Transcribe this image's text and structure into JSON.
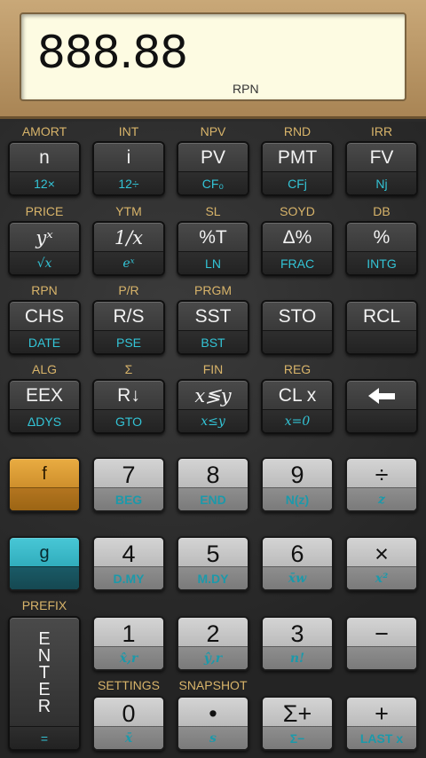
{
  "display": {
    "value": "888.88",
    "mode": "RPN"
  },
  "rows": [
    {
      "labels": [
        "AMORT",
        "INT",
        "NPV",
        "RND",
        "IRR"
      ],
      "keys": [
        {
          "main": "n",
          "sub": "12×"
        },
        {
          "main": "i",
          "sub": "12÷"
        },
        {
          "main": "PV",
          "sub": "CF₀"
        },
        {
          "main": "PMT",
          "sub": "CFj"
        },
        {
          "main": "FV",
          "sub": "Nj"
        }
      ]
    },
    {
      "labels": [
        "PRICE",
        "YTM",
        "SL",
        "SOYD",
        "DB"
      ],
      "keys": [
        {
          "main": "yˣ",
          "sub": "√x"
        },
        {
          "main": "1/x",
          "sub": "eˣ"
        },
        {
          "main": "%T",
          "sub": "LN"
        },
        {
          "main": "Δ%",
          "sub": "FRAC"
        },
        {
          "main": "%",
          "sub": "INTG"
        }
      ]
    },
    {
      "labels": [
        "RPN",
        "P/R",
        "PRGM",
        "",
        ""
      ],
      "keys": [
        {
          "main": "CHS",
          "sub": "DATE"
        },
        {
          "main": "R/S",
          "sub": "PSE"
        },
        {
          "main": "SST",
          "sub": "BST"
        },
        {
          "main": "STO",
          "sub": ""
        },
        {
          "main": "RCL",
          "sub": ""
        }
      ]
    },
    {
      "labels": [
        "ALG",
        "Σ",
        "FIN",
        "REG",
        ""
      ],
      "keys": [
        {
          "main": "EEX",
          "sub": "ΔDYS"
        },
        {
          "main": "R↓",
          "sub": "GTO"
        },
        {
          "main": "x≶y",
          "sub": "x≤y"
        },
        {
          "main": "CL x",
          "sub": "x=0"
        },
        {
          "main": "",
          "sub": ""
        }
      ]
    }
  ],
  "lower": {
    "f": {
      "main": "f",
      "sub": ""
    },
    "g": {
      "main": "g",
      "sub": ""
    },
    "row5": [
      {
        "main": "7",
        "sub": "BEG"
      },
      {
        "main": "8",
        "sub": "END"
      },
      {
        "main": "9",
        "sub": "N(z)"
      },
      {
        "main": "÷",
        "sub": "z"
      }
    ],
    "row6": [
      {
        "main": "4",
        "sub": "D.MY"
      },
      {
        "main": "5",
        "sub": "M.DY"
      },
      {
        "main": "6",
        "sub": "x̄w"
      },
      {
        "main": "×",
        "sub": "x²"
      }
    ],
    "prefix_label": "PREFIX",
    "enter": {
      "main": "ENTER",
      "sub": "="
    },
    "row7": [
      {
        "main": "1",
        "sub": "x̂,r"
      },
      {
        "main": "2",
        "sub": "ŷ,r"
      },
      {
        "main": "3",
        "sub": "n!"
      },
      {
        "main": "−",
        "sub": ""
      }
    ],
    "row8_labels": [
      "SETTINGS",
      "SNAPSHOT"
    ],
    "row8": [
      {
        "main": "0",
        "sub": "x̄"
      },
      {
        "main": "•",
        "sub": "s"
      },
      {
        "main": "Σ+",
        "sub": "Σ−"
      },
      {
        "main": "+",
        "sub": "LAST x"
      }
    ]
  },
  "colors": {
    "bezel": "#b89466",
    "lcd": "#fdfbe2",
    "gold_label": "#d8b46a",
    "blue_label": "#33c4d6",
    "f_key": "#d9962e",
    "g_key": "#2bb0c0"
  }
}
